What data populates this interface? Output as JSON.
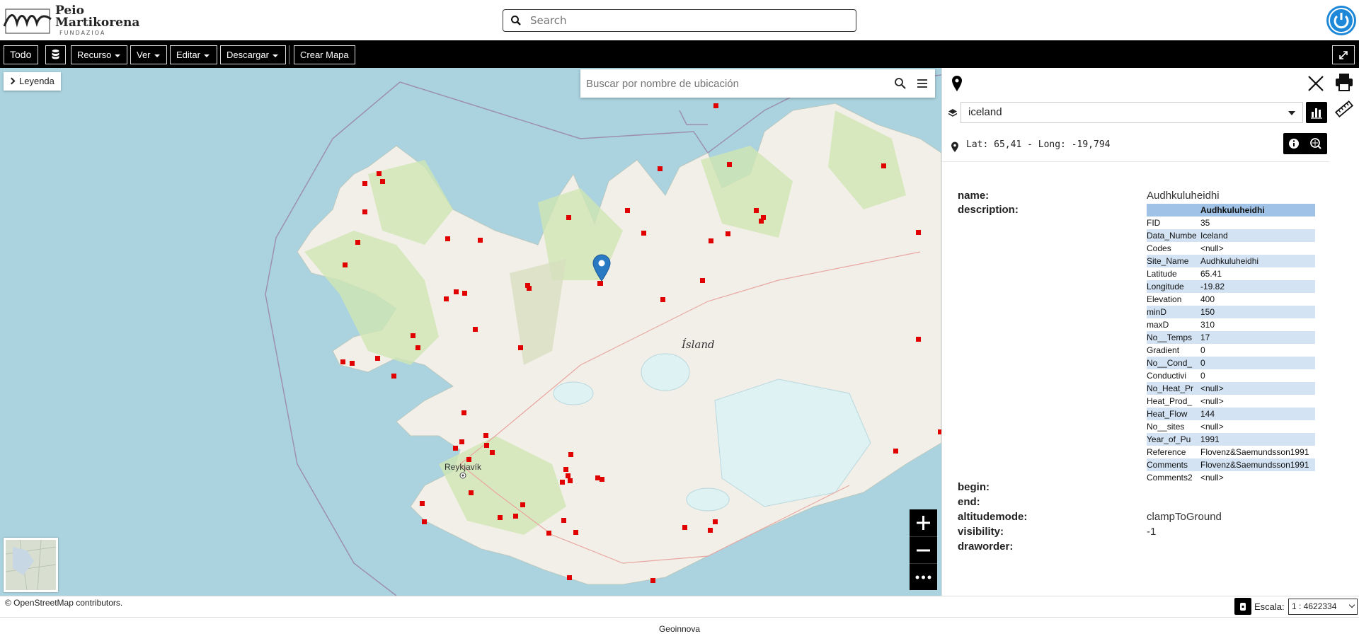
{
  "header": {
    "logo": {
      "line1": "Peio",
      "line2": "Martikorena",
      "line3": "FUNDAZIOA"
    },
    "search_placeholder": "Search",
    "icons": {
      "search": "search-icon",
      "power": "power-icon"
    }
  },
  "toolbar": {
    "all_label": "Todo",
    "resource_label": "Recurso",
    "view_label": "Ver",
    "edit_label": "Editar",
    "download_label": "Descargar",
    "create_map_label": "Crear Mapa"
  },
  "map": {
    "legend_label": "Leyenda",
    "location_search_placeholder": "Buscar por nombre de ubicación",
    "place_label": "Ísland",
    "city_label": "Reykjavík",
    "attribution": "© OpenStreetMap contributors."
  },
  "panel": {
    "layer": "iceland",
    "coords": "Lat: 65,41 - Long: -19,794",
    "properties": {
      "name_label": "name:",
      "name_value": "Audhkuluheidhi",
      "description_label": "description:",
      "begin_label": "begin:",
      "end_label": "end:",
      "altitudemode_label": "altitudemode:",
      "altitudemode_value": "clampToGround",
      "visibility_label": "visibility:",
      "visibility_value": "-1",
      "draworder_label": "draworder:"
    },
    "table_header": "Audhkuluheidhi",
    "table_rows": [
      [
        "FID",
        "35"
      ],
      [
        "Data_Numbe",
        "Iceland"
      ],
      [
        "Codes",
        "<null>"
      ],
      [
        "Site_Name",
        "Audhkuluheidhi"
      ],
      [
        "Latitude",
        "65.41"
      ],
      [
        "Longitude",
        "-19.82"
      ],
      [
        "Elevation",
        "400"
      ],
      [
        "minD",
        "150"
      ],
      [
        "maxD",
        "310"
      ],
      [
        "No__Temps",
        "17"
      ],
      [
        "Gradient",
        "0"
      ],
      [
        "No__Cond_",
        "0"
      ],
      [
        "Conductivi",
        "0"
      ],
      [
        "No_Heat_Pr",
        "<null>"
      ],
      [
        "Heat_Prod_",
        "<null>"
      ],
      [
        "Heat_Flow",
        "144"
      ],
      [
        "No__sites",
        "<null>"
      ],
      [
        "Year_of_Pu",
        "1991"
      ],
      [
        "Reference",
        "Flovenz&Saemundsson1991"
      ],
      [
        "Comments",
        "Flovenz&Saemundsson1991"
      ],
      [
        "Comments2",
        "<null>"
      ]
    ]
  },
  "scale": {
    "label": "Escala:",
    "value": "1 : 4622334"
  },
  "footer": {
    "text": "Geoinnova"
  }
}
